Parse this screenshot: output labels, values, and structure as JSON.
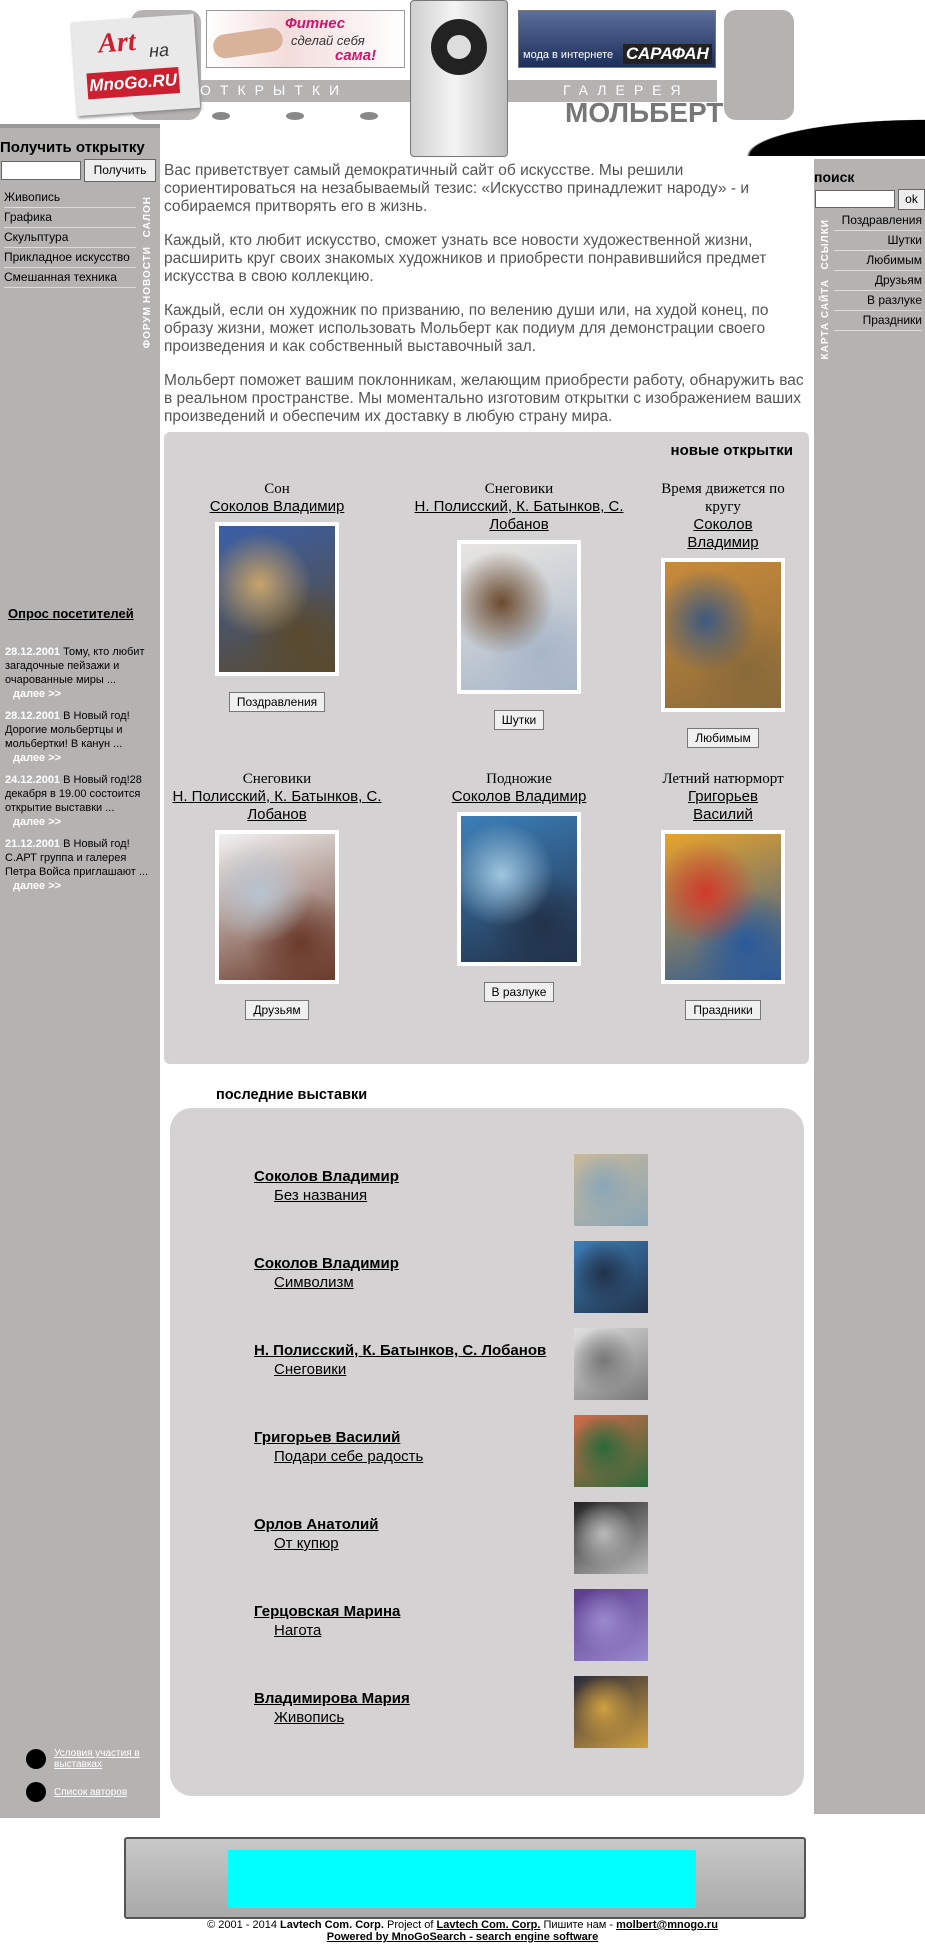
{
  "header": {
    "logo_art": "Art",
    "logo_na": "на",
    "logo_mnogo": "MnoGo.RU",
    "banner1_line1": "Фитнес",
    "banner1_line2": "сделай себя",
    "banner1_line3": "сама!",
    "banner2_line1": "мода в интернете",
    "banner2_line2": "САРАФАН",
    "otkrytki": "ОТКРЫТКИ",
    "galereya": "ГАЛЕРЕЯ",
    "molbert": "МОЛЬБЕРТ"
  },
  "left": {
    "get_title": "Получить открытку",
    "get_button": "Получить",
    "menu": [
      "Живопись",
      "Графика",
      "Скульптура",
      "Прикладное искусство",
      "Смешанная техника"
    ],
    "vert_salon": "САЛОН",
    "vert_news": "НОВОСТИ",
    "vert_forum": "ФОРУМ",
    "poll": "Опрос посетителей",
    "news": [
      {
        "date": "28.12.2001",
        "text": "Тому, кто любит загадочные пейзажи и очарованные миры ...",
        "more": "далее >>"
      },
      {
        "date": "28.12.2001",
        "text": "В Новый год! Дорогие мольбертцы и мольбертки! В канун ...",
        "more": "далее >>"
      },
      {
        "date": "24.12.2001",
        "text": "В Новый год!28 декабря в 19.00 состоится открытие выставки ...",
        "more": "далее >>"
      },
      {
        "date": "21.12.2001",
        "text": "В Новый год! С.АРТ группа и галерея Петра Войса приглашают ...",
        "more": "далее >>"
      }
    ],
    "link_conditions": "Условия участия в выставках",
    "link_authors": "Список авторов"
  },
  "right": {
    "title": "поиск",
    "button": "ok",
    "menu": [
      "Поздравления",
      "Шутки",
      "Любимым",
      "Друзьям",
      "В разлуке",
      "Праздники"
    ],
    "vert_links": "ССЫЛКИ",
    "vert_map": "КАРТА САЙТА"
  },
  "intro": [
    "Вас приветствует самый демократичный сайт об искусстве. Мы решили сориентироваться на незабываемый тезис: «Искусство принадлежит народу» - и собираемся притворять его в жизнь.",
    "Каждый, кто любит искусство, сможет узнать все новости художественной жизни, расширить круг своих знакомых художников и приобрести понравившийся предмет искусства в свою коллекцию.",
    "Каждый, если он художник по призванию, по велению души или, на худой конец, по образу жизни, может использовать Мольберт как подиум для демонстрации своего произведения и как собственный выставочный зал.",
    "Мольберт поможет вашим поклонникам, желающим приобрести работу, обнаружить вас в реальном пространстве. Мы моментально изготовим открытки с изображением ваших произведений и обеспечим их доставку в любую страну мира."
  ],
  "cards_title": "новые открытки",
  "cards": [
    {
      "title": "Сон",
      "author": "Соколов Владимир",
      "button": "Поздравления",
      "colors": [
        "#3a5fa8",
        "#c7a46a",
        "#5a4a2c"
      ]
    },
    {
      "title": "Снеговики",
      "author": "Н. Полисский, К. Батынков, С. Лобанов",
      "button": "Шутки",
      "colors": [
        "#e8e6e2",
        "#6b4a2e",
        "#a7b6c8"
      ]
    },
    {
      "title": "Время движется по кругу",
      "author": "Соколов Владимир",
      "button": "Любимым",
      "colors": [
        "#c98b3a",
        "#3d5a80",
        "#8a6a3a"
      ]
    },
    {
      "title": "Снеговики",
      "author": "Н. Полисский, К. Батынков, С. Лобанов",
      "button": "Друзьям",
      "colors": [
        "#f2f2f2",
        "#b8c4d0",
        "#6a3a2a"
      ]
    },
    {
      "title": "Подножие",
      "author": "Соколов Владимир",
      "button": "В разлуке",
      "colors": [
        "#3c7fb8",
        "#9fc7e0",
        "#22324a"
      ]
    },
    {
      "title": "Летний натюрморт",
      "author": "Григорьев Василий",
      "button": "Праздники",
      "colors": [
        "#e8a32a",
        "#d13a2a",
        "#2a5a9a"
      ]
    }
  ],
  "exh_title": "последние выставки",
  "exhibitions": [
    {
      "author": "Соколов Владимир",
      "title": "Без названия",
      "colors": [
        "#c8b89a",
        "#8aa6b8"
      ]
    },
    {
      "author": "Соколов Владимир",
      "title": "Символизм",
      "colors": [
        "#3c7fb8",
        "#22324a"
      ]
    },
    {
      "author": "Н. Полисский, К. Батынков, С. Лобанов",
      "title": "Снеговики",
      "colors": [
        "#e0e0e0",
        "#777777"
      ]
    },
    {
      "author": "Григорьев Василий",
      "title": "Подари себе радость",
      "colors": [
        "#d46a4a",
        "#2a6a3a"
      ]
    },
    {
      "author": "Орлов Анатолий",
      "title": "От купюр",
      "colors": [
        "#222222",
        "#bbbbbb"
      ]
    },
    {
      "author": "Герцовская Марина",
      "title": "Нагота",
      "colors": [
        "#5a3a8a",
        "#9a8ad0"
      ]
    },
    {
      "author": "Владимирова Мария",
      "title": "Живопись",
      "colors": [
        "#2a2a3a",
        "#d0a040"
      ]
    }
  ],
  "footer": {
    "line1_pre": "© 2001 - 2014",
    "company": "Lavtech Com. Corp.",
    "project_of": "Project of",
    "company2": "Lavtech Com. Corp.",
    "write_us": "Пишите нам -",
    "email": "molbert@mnogo.ru",
    "powered": "Powered by MnoGoSearch - search engine software"
  }
}
